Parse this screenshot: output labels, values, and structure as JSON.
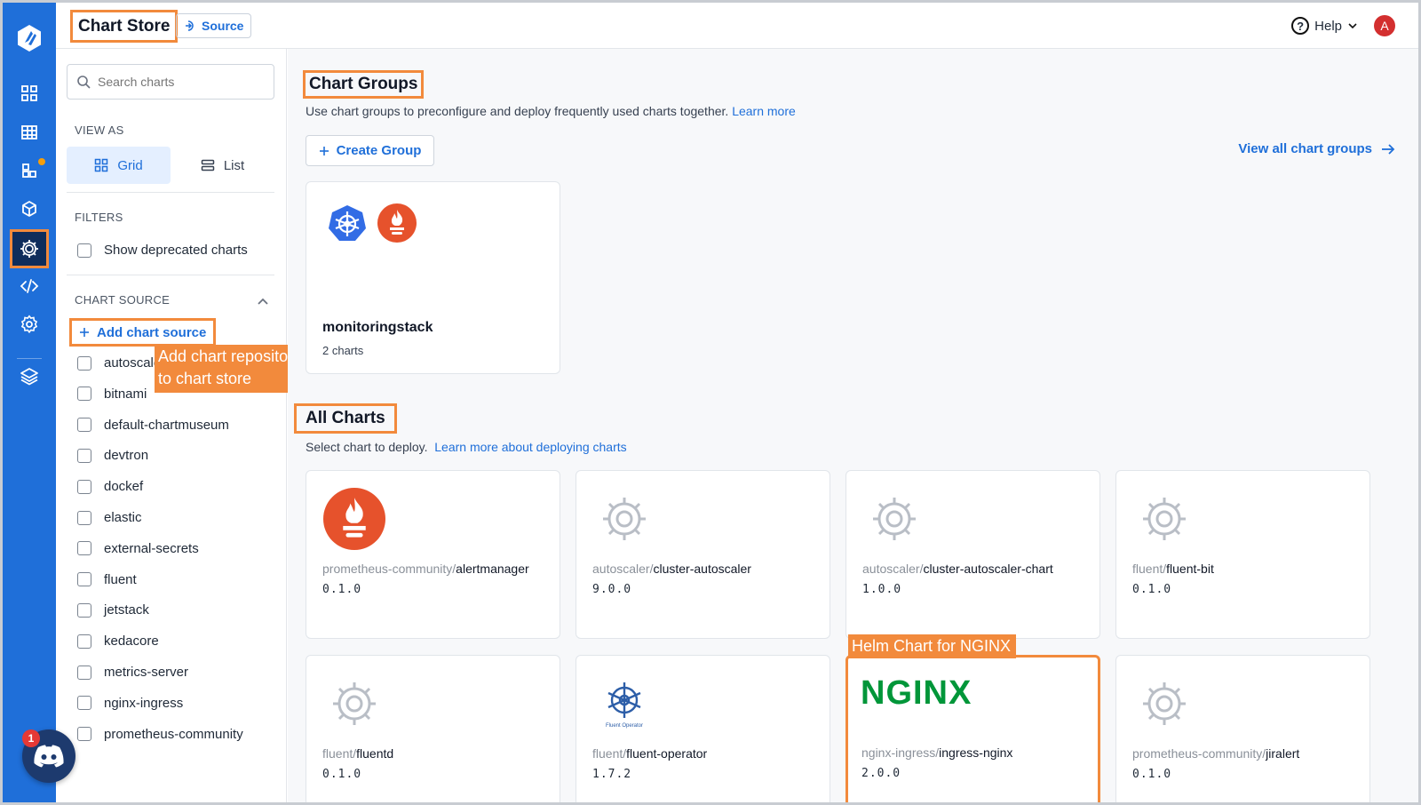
{
  "header": {
    "title": "Chart Store",
    "source_button": "Source",
    "help_label": "Help",
    "avatar_initial": "A"
  },
  "nav": {
    "items": [
      "home-icon",
      "grid-icon",
      "apps-icon",
      "cube-icon",
      "helm-icon",
      "code-icon",
      "gear-icon",
      "stack-icon"
    ],
    "active": "helm-icon",
    "discord_badge": "1"
  },
  "filters": {
    "search_placeholder": "Search charts",
    "view_as_label": "VIEW AS",
    "view_grid": "Grid",
    "view_list": "List",
    "filters_label": "FILTERS",
    "show_deprecated": "Show deprecated charts",
    "chart_source_label": "CHART SOURCE",
    "add_chart_source": "Add chart source",
    "sources": [
      "autoscaler",
      "bitnami",
      "default-chartmuseum",
      "devtron",
      "dockef",
      "elastic",
      "external-secrets",
      "fluent",
      "jetstack",
      "kedacore",
      "metrics-server",
      "nginx-ingress",
      "prometheus-community"
    ]
  },
  "callouts": {
    "add_repo": [
      "Add chart repository",
      "to chart store"
    ],
    "nginx": "Helm Chart for NGINX"
  },
  "groups": {
    "title": "Chart Groups",
    "description": "Use chart groups to preconfigure and deploy frequently used charts together.",
    "learn_more": "Learn more",
    "create_group": "Create Group",
    "view_all": "View all chart groups",
    "card": {
      "name": "monitoringstack",
      "count": "2 charts"
    }
  },
  "all_charts": {
    "title": "All Charts",
    "description": "Select chart to deploy.",
    "learn_more": "Learn more about deploying charts",
    "charts": [
      {
        "repo": "prometheus-community",
        "name": "alertmanager",
        "version": "0.1.0",
        "icon": "prometheus-icon"
      },
      {
        "repo": "autoscaler",
        "name": "cluster-autoscaler",
        "version": "9.0.0",
        "icon": "helm-default-icon"
      },
      {
        "repo": "autoscaler",
        "name": "cluster-autoscaler-chart",
        "version": "1.0.0",
        "icon": "helm-default-icon"
      },
      {
        "repo": "fluent",
        "name": "fluent-bit",
        "version": "0.1.0",
        "icon": "helm-default-icon"
      },
      {
        "repo": "fluent",
        "name": "fluentd",
        "version": "0.1.0",
        "icon": "helm-default-icon"
      },
      {
        "repo": "fluent",
        "name": "fluent-operator",
        "version": "1.7.2",
        "icon": "fluent-operator-icon",
        "icon_caption": "Fluent Operator"
      },
      {
        "repo": "nginx-ingress",
        "name": "ingress-nginx",
        "version": "2.0.0",
        "icon": "nginx-logo",
        "logo_text": "NGINX"
      },
      {
        "repo": "prometheus-community",
        "name": "jiralert",
        "version": "0.1.0",
        "icon": "helm-default-icon"
      }
    ]
  },
  "colors": {
    "brand": "#1f6fd9",
    "highlight": "#f28a3c",
    "prometheus": "#e6522c",
    "nginx": "#009639"
  }
}
